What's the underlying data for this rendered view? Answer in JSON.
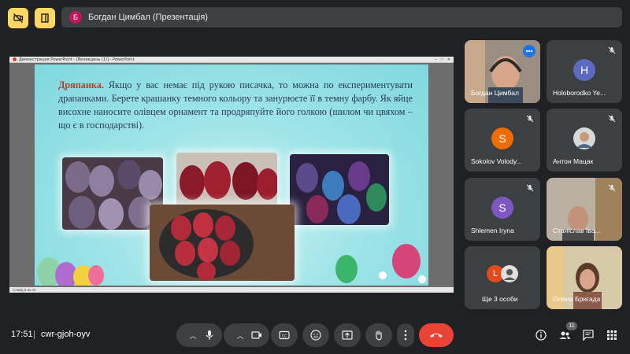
{
  "header": {
    "presenter_initial": "Б",
    "presenter_label": "Богдан Цимбал (Презентація)"
  },
  "presentation": {
    "window_title": "Демонстрация PowerPoint - [Великдень (1)] - PowerPoint",
    "status_text": "Слайд 8 из 34",
    "slide_keyword": "Дряпанка.",
    "slide_text": " Якщо у вас немає під рукою писачка, то можна по експериментувати драпанками. Берете крашанку темного кольору та занурюєте її в темну фарбу. Як яйце висохне наносите олівцем орнамент та продряпуйте його голкою (шилом чи цвяхом – що є в господарстві)."
  },
  "participants": [
    {
      "name": "Богдан Цимбал",
      "type": "video"
    },
    {
      "name": "Holoborodko Ye...",
      "initial": "H",
      "color": "#5c6bc0",
      "muted": true
    },
    {
      "name": "Sokolov Volody...",
      "initial": "S",
      "color": "#ef6c00",
      "muted": true
    },
    {
      "name": "Антон Мацак",
      "type": "photo",
      "muted": true
    },
    {
      "name": "Shlemen Iryna",
      "initial": "S",
      "color": "#7e57c2",
      "muted": true
    },
    {
      "name": "Станіслав Іва...",
      "type": "video",
      "muted": true
    },
    {
      "name": "Ще 3 особи",
      "initial": "L",
      "color": "#e64a19"
    },
    {
      "name": "Олена Бригада",
      "type": "video"
    }
  ],
  "footer": {
    "time": "17:51",
    "meeting_code": "cwr-gjoh-oyv",
    "participant_count": "11"
  },
  "colors": {
    "background": "#202124",
    "tile": "#3c4043",
    "end_call": "#ea4335",
    "accent_yellow": "#fdd663"
  }
}
